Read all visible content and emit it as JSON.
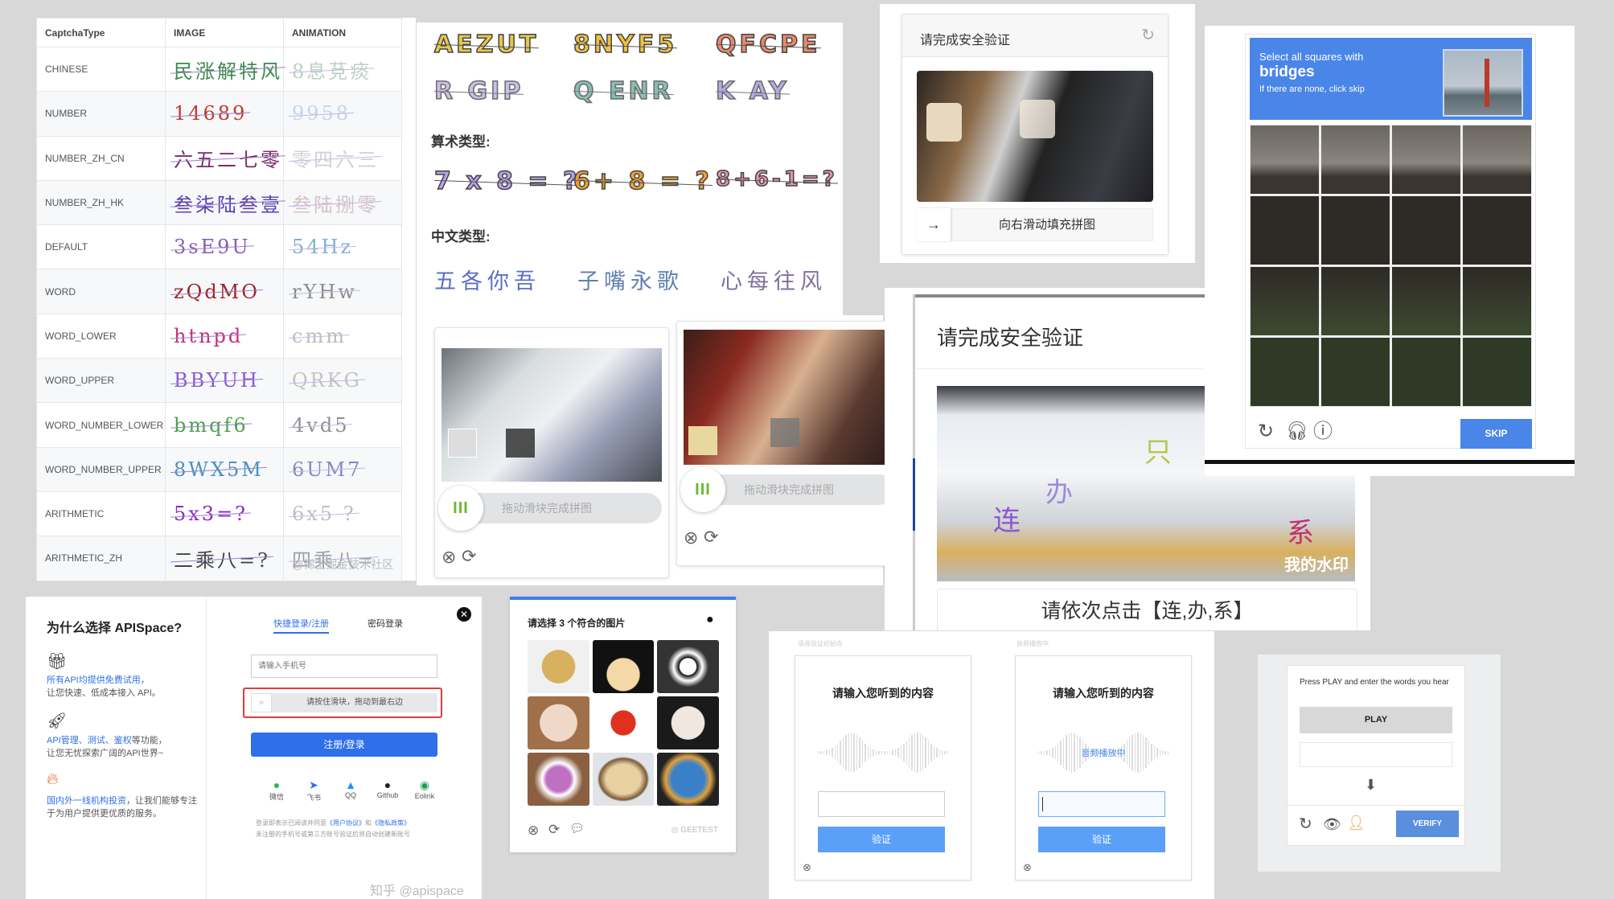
{
  "captcha_table": {
    "headers": [
      "CaptchaType",
      "IMAGE",
      "ANIMATION"
    ],
    "rows": [
      {
        "type": "CHINESE",
        "image": "民涨解特风",
        "animation": "8息莌痰",
        "c1": "#3a8a4a",
        "c2": "#8a9"
      },
      {
        "type": "NUMBER",
        "image": "14689",
        "animation": "9958",
        "c1": "#c0392b",
        "c2": "#9bd"
      },
      {
        "type": "NUMBER_ZH_CN",
        "image": "六五二七零",
        "animation": "零四六三",
        "c1": "#7a2a6a",
        "c2": "#aab"
      },
      {
        "type": "NUMBER_ZH_HK",
        "image": "叁柒陆叁壹",
        "animation": "叁陆捌零",
        "c1": "#5a3fb0",
        "c2": "#b99"
      },
      {
        "type": "DEFAULT",
        "image": "3sE9U",
        "animation": "54Hz",
        "c1": "#8a5ab0",
        "c2": "#1d6fa8"
      },
      {
        "type": "WORD",
        "image": "zQdMO",
        "animation": "rYHw",
        "c1": "#a02020",
        "c2": "#333"
      },
      {
        "type": "WORD_LOWER",
        "image": "htnpd",
        "animation": "cmm",
        "c1": "#c0307a",
        "c2": "#887"
      },
      {
        "type": "WORD_UPPER",
        "image": "BBYUH",
        "animation": "QRKG",
        "c1": "#8a5ad0",
        "c2": "#998"
      },
      {
        "type": "WORD_NUMBER_LOWER",
        "image": "bmqf6",
        "animation": "4vd5",
        "c1": "#4aa04a",
        "c2": "#333"
      },
      {
        "type": "WORD_NUMBER_UPPER",
        "image": "8WX5M",
        "animation": "6UM7",
        "c1": "#4a90c0",
        "c2": "#2a2a90"
      },
      {
        "type": "ARITHMETIC",
        "image": "5x3=?",
        "animation": "6x5 ?",
        "c1": "#8a2ac0",
        "c2": "#889"
      },
      {
        "type": "ARITHMETIC_ZH",
        "image": "二乘八=?",
        "animation": "四乘八=",
        "c1": "#444",
        "c2": "#556"
      }
    ],
    "watermark": "@稀土掘金技术社区"
  },
  "samples": {
    "gif_row1": [
      "AEZUT",
      "8NYF5",
      "QFCPE"
    ],
    "gif_row2": [
      "R GIP",
      "Q ENR",
      "K  AY"
    ],
    "arith_label": "算术类型:",
    "arith": [
      "7 x 8 = ?",
      "6+ 8 = ?",
      "8+6-1=?"
    ],
    "chinese_label": "中文类型:",
    "chinese": [
      "五各你吾",
      "子嘴永歌",
      "心每往风"
    ]
  },
  "anime_sliders": {
    "hint": "拖动滑块完成拼图",
    "handle": "III"
  },
  "slider_puzzle": {
    "title": "请完成安全验证",
    "slider_hint": "向右滑动填充拼图"
  },
  "click_captcha": {
    "title": "请完成安全验证",
    "instruction": "请依次点击【连,办,系】",
    "watermark": "我的水印",
    "chars": [
      "连",
      "办",
      "系",
      "只"
    ]
  },
  "recaptcha": {
    "line1": "Select all squares with",
    "keyword": "bridges",
    "line3": "If there are none, click skip",
    "skip": "SKIP",
    "accent": "#4a86e8"
  },
  "apispace": {
    "title": "为什么选择 APISpace?",
    "features": [
      {
        "highlight": "所有API均提供免费试用，",
        "text": "让您快速、低成本接入 API。"
      },
      {
        "highlight": "API管理、测试、鉴权",
        "rest": "等功能，",
        "text": "让您无忧探索广阔的API世界~"
      },
      {
        "highlight": "国内外一线机构投资",
        "rest": "，让我们能够专注",
        "text": "于为用户提供更优质的服务。"
      }
    ],
    "tabs": [
      "快捷登录/注册",
      "密码登录"
    ],
    "phone_placeholder": "请输入手机号",
    "slider_hint": "请按住滑块，拖动到最右边",
    "slider_handle": "»",
    "submit": "注册/登录",
    "social": [
      "微信",
      "飞书",
      "QQ",
      "Github",
      "Eolink"
    ],
    "terms_prefix": "登录即表示已阅读并同意",
    "terms_link1": "《用户协议》",
    "terms_and": "和",
    "terms_link2": "《隐私政策》",
    "terms_line2": "未注册的手机号或第三方账号验证后将自动创建新账号",
    "watermark": "知乎 @apispace",
    "accent": "#2f6fe8"
  },
  "geetest": {
    "title": "请选择 3 个符合的图片",
    "brand": "GEETEST"
  },
  "audio": {
    "state_labels": [
      "语音验证初始态",
      "音频播放中"
    ],
    "title": "请输入您听到的内容",
    "playing": "音频播放中",
    "verify": "验证",
    "accent": "#5aa0f8"
  },
  "audio_recaptcha": {
    "instruction": "Press PLAY and enter the words you hear",
    "play": "PLAY",
    "verify": "VERIFY"
  }
}
